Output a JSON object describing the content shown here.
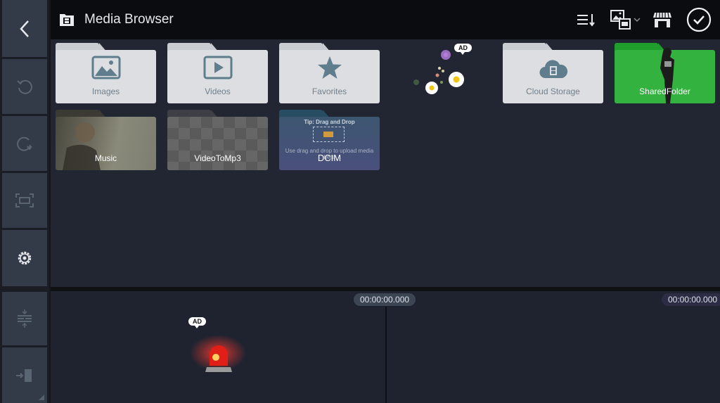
{
  "header": {
    "title": "Media Browser",
    "title_icon": "media-folder-icon",
    "actions": [
      {
        "name": "sort-icon",
        "label": "Sort"
      },
      {
        "name": "media-type-filter-icon",
        "label": "Media type"
      },
      {
        "name": "store-icon",
        "label": "Store"
      },
      {
        "name": "confirm-check-icon",
        "label": "Done"
      }
    ]
  },
  "left_rail": {
    "buttons": [
      {
        "name": "back-button",
        "icon": "chevron-left-icon"
      },
      {
        "name": "undo-button",
        "icon": "undo-icon"
      },
      {
        "name": "redo-button",
        "icon": "redo-icon"
      },
      {
        "name": "fit-screen-button",
        "icon": "fit-screen-icon"
      },
      {
        "name": "settings-button",
        "icon": "gear-icon"
      },
      {
        "name": "split-button",
        "icon": "split-layers-icon"
      },
      {
        "name": "exit-button",
        "icon": "exit-arrow-icon"
      }
    ]
  },
  "folders": [
    {
      "label": "Images",
      "icon": "image-icon",
      "style": "light"
    },
    {
      "label": "Videos",
      "icon": "play-icon",
      "style": "light"
    },
    {
      "label": "Favorites",
      "icon": "star-icon",
      "style": "light"
    },
    {
      "label": "Cloud Storage",
      "icon": "cloud-film-icon",
      "style": "light"
    },
    {
      "label": "SharedFolder",
      "icon": "person-thumbnail",
      "style": "green"
    },
    {
      "label": "Music",
      "icon": "photo-thumbnail",
      "style": "photo"
    },
    {
      "label": "VideoToMp3",
      "icon": "transparent-thumbnail",
      "style": "checker"
    },
    {
      "label": "DCIM",
      "icon": "tip-thumbnail",
      "style": "blue",
      "tip_title": "Tip: Drag and Drop",
      "tip_text": "Use drag and drop to upload media here"
    }
  ],
  "ads": {
    "browser_ad_label": "AD",
    "timeline_ad_label": "AD"
  },
  "timeline": {
    "playhead_time": "00:00:00.000",
    "end_time": "00:00:00.000"
  },
  "colors": {
    "accent_green": "#33b23f",
    "folder_light": "#dcdee1",
    "icon_slate": "#5f7d8c"
  }
}
